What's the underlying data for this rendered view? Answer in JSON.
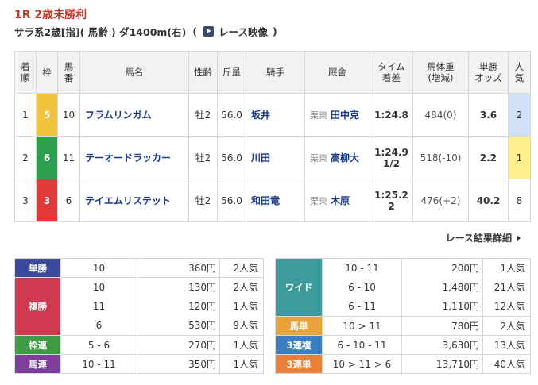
{
  "race": {
    "title": "1R 2歳未勝利",
    "conditions": "サラ系2歳[指]( 馬齢 ) ダ1400m(右)",
    "paren_open": "(",
    "video_label": "レース映像",
    "paren_close": ")"
  },
  "table": {
    "headers": {
      "rank": [
        "着",
        "順"
      ],
      "waku": "枠",
      "umaban": [
        "馬",
        "番"
      ],
      "horse": "馬名",
      "sexage": "性齢",
      "weight": "斤量",
      "jockey": "騎手",
      "stable": "厩舎",
      "time": [
        "タイム",
        "着差"
      ],
      "body": [
        "馬体重",
        "(増減)"
      ],
      "odds": [
        "単勝",
        "オッズ"
      ],
      "pop": [
        "人",
        "気"
      ]
    },
    "rows": [
      {
        "rank": "1",
        "waku": "5",
        "umaban": "10",
        "horse": "フラムリンガム",
        "sexage": "牡2",
        "kinryo": "56.0",
        "jockey": "坂井",
        "area": "栗東",
        "trainer": "田中克",
        "time": "1:24.8",
        "margin": "",
        "body": "484(0)",
        "odds": "3.6",
        "pop": "2"
      },
      {
        "rank": "2",
        "waku": "6",
        "umaban": "11",
        "horse": "テーオードラッカー",
        "sexage": "牡2",
        "kinryo": "56.0",
        "jockey": "川田",
        "area": "栗東",
        "trainer": "高柳大",
        "time": "1:24.9",
        "margin": "1/2",
        "body": "518(-10)",
        "odds": "2.2",
        "pop": "1"
      },
      {
        "rank": "3",
        "waku": "3",
        "umaban": "6",
        "horse": "テイエムリステット",
        "sexage": "牡2",
        "kinryo": "56.0",
        "jockey": "和田竜",
        "area": "栗東",
        "trainer": "木原",
        "time": "1:25.2",
        "margin": "2",
        "body": "476(+2)",
        "odds": "40.2",
        "pop": "8"
      }
    ]
  },
  "detail_link": "レース結果詳細",
  "payout_left": {
    "tansho": {
      "label": "単勝",
      "combo": "10",
      "yen": "360円",
      "pop": "2人気"
    },
    "fukusho": {
      "label": "複勝",
      "combos": [
        "10",
        "11",
        "6"
      ],
      "yens": [
        "130円",
        "120円",
        "530円"
      ],
      "pops": [
        "2人気",
        "1人気",
        "9人気"
      ]
    },
    "wakuren": {
      "label": "枠連",
      "combo": "5 - 6",
      "yen": "270円",
      "pop": "1人気"
    },
    "umaren": {
      "label": "馬連",
      "combo": "10 - 11",
      "yen": "350円",
      "pop": "1人気"
    }
  },
  "payout_right": {
    "wide": {
      "label": "ワイド",
      "combos": [
        "10 - 11",
        "6 - 10",
        "6 - 11"
      ],
      "yens": [
        "200円",
        "1,480円",
        "1,110円"
      ],
      "pops": [
        "1人気",
        "21人気",
        "12人気"
      ]
    },
    "umatan": {
      "label": "馬単",
      "combo": "10 > 11",
      "yen": "780円",
      "pop": "2人気"
    },
    "sanrenpuku": {
      "label": "3連複",
      "combo": "6 - 10 - 11",
      "yen": "3,630円",
      "pop": "13人気"
    },
    "sanrentan": {
      "label": "3連単",
      "combo": "10 > 11 > 6",
      "yen": "13,710円",
      "pop": "40人気"
    }
  }
}
